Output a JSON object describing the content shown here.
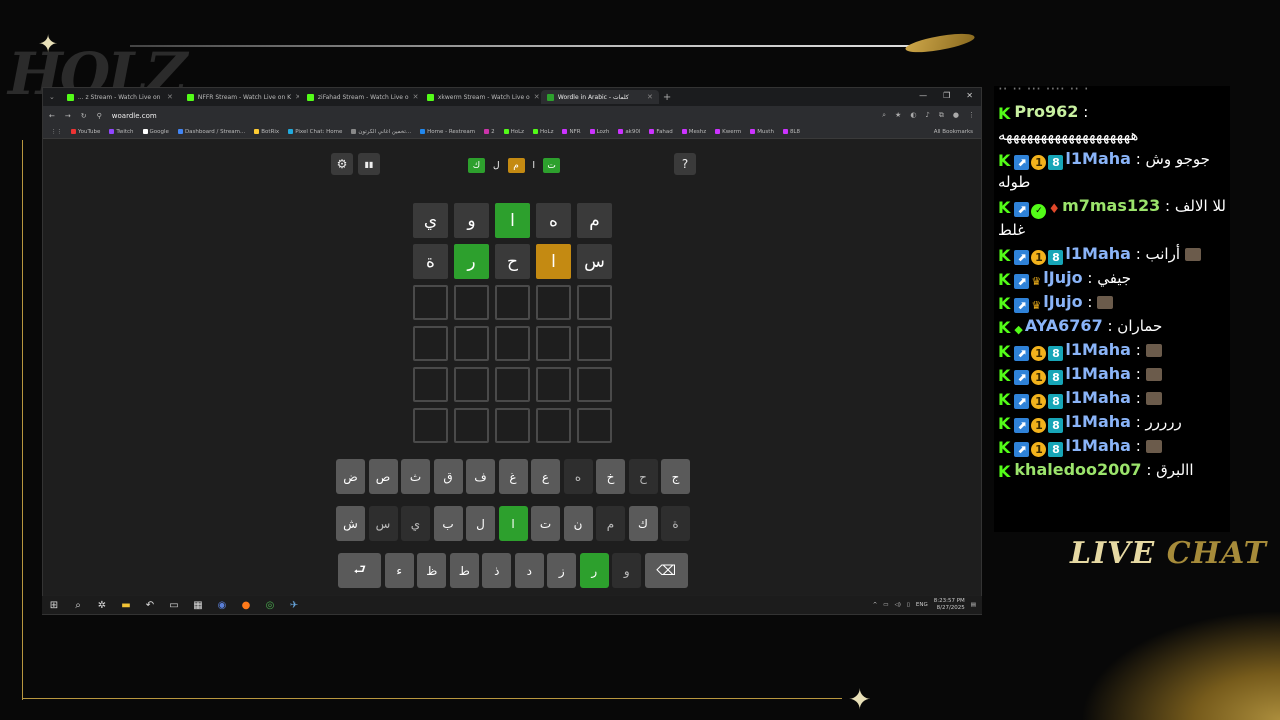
{
  "overlay": {
    "logo_text": "HOLZ",
    "live_label": "LIVE",
    "chat_label": "CHAT"
  },
  "browser": {
    "tabs": [
      {
        "label": "... z Stream - Watch Live on",
        "active": false
      },
      {
        "label": "NFFR Stream - Watch Live on K",
        "active": false
      },
      {
        "label": "ziFahad Stream - Watch Live o",
        "active": false
      },
      {
        "label": "xkwerm Stream - Watch Live o",
        "active": false
      },
      {
        "label": "Wordle in Arabic - كلمات",
        "active": true
      }
    ],
    "new_tab": "+",
    "url": "woardle.com",
    "bookmarks": [
      "YouTube",
      "Twitch",
      "Google",
      "Dashboard / Stream...",
      "BotRix",
      "Pixel Chat: Home",
      "تخمين اغاني الكرتون...",
      "Home - Restream",
      "2",
      "HoLz",
      "HoLz",
      "NFR",
      "Lozh",
      "ak90l",
      "Fahad",
      "Meshz",
      "Kwerm",
      "Musth",
      "8L8"
    ],
    "all_bookmarks": "All Bookmarks"
  },
  "game": {
    "settings_icon": "⚙",
    "stats_icon": "▮▮",
    "help_label": "?",
    "title_tiles": [
      {
        "char": "ك",
        "state": "green"
      },
      {
        "char": "ل",
        "state": "none"
      },
      {
        "char": "م",
        "state": "yellow"
      },
      {
        "char": "ا",
        "state": "none"
      },
      {
        "char": "ت",
        "state": "green"
      }
    ],
    "board": [
      [
        {
          "c": "ي",
          "s": "filled"
        },
        {
          "c": "و",
          "s": "filled"
        },
        {
          "c": "ا",
          "s": "green"
        },
        {
          "c": "ه",
          "s": "filled"
        },
        {
          "c": "م",
          "s": "filled"
        }
      ],
      [
        {
          "c": "ة",
          "s": "filled"
        },
        {
          "c": "ر",
          "s": "green"
        },
        {
          "c": "ح",
          "s": "filled"
        },
        {
          "c": "ا",
          "s": "yellow"
        },
        {
          "c": "س",
          "s": "filled"
        }
      ],
      [
        {
          "c": "",
          "s": "empty"
        },
        {
          "c": "",
          "s": "empty"
        },
        {
          "c": "",
          "s": "empty"
        },
        {
          "c": "",
          "s": "empty"
        },
        {
          "c": "",
          "s": "empty"
        }
      ],
      [
        {
          "c": "",
          "s": "empty"
        },
        {
          "c": "",
          "s": "empty"
        },
        {
          "c": "",
          "s": "empty"
        },
        {
          "c": "",
          "s": "empty"
        },
        {
          "c": "",
          "s": "empty"
        }
      ],
      [
        {
          "c": "",
          "s": "empty"
        },
        {
          "c": "",
          "s": "empty"
        },
        {
          "c": "",
          "s": "empty"
        },
        {
          "c": "",
          "s": "empty"
        },
        {
          "c": "",
          "s": "empty"
        }
      ],
      [
        {
          "c": "",
          "s": "empty"
        },
        {
          "c": "",
          "s": "empty"
        },
        {
          "c": "",
          "s": "empty"
        },
        {
          "c": "",
          "s": "empty"
        },
        {
          "c": "",
          "s": "empty"
        }
      ]
    ],
    "keyboard": [
      [
        {
          "k": "ض"
        },
        {
          "k": "ص"
        },
        {
          "k": "ث"
        },
        {
          "k": "ق"
        },
        {
          "k": "ف"
        },
        {
          "k": "غ"
        },
        {
          "k": "ع"
        },
        {
          "k": "ه",
          "s": "used"
        },
        {
          "k": "خ"
        },
        {
          "k": "ح",
          "s": "used"
        },
        {
          "k": "ج"
        }
      ],
      [
        {
          "k": "ش"
        },
        {
          "k": "س",
          "s": "used"
        },
        {
          "k": "ي",
          "s": "used"
        },
        {
          "k": "ب"
        },
        {
          "k": "ل"
        },
        {
          "k": "ا",
          "s": "green"
        },
        {
          "k": "ت"
        },
        {
          "k": "ن"
        },
        {
          "k": "م",
          "s": "used"
        },
        {
          "k": "ك"
        },
        {
          "k": "ة",
          "s": "used"
        }
      ],
      [
        {
          "k": "⮐",
          "s": "wide"
        },
        {
          "k": "ء"
        },
        {
          "k": "ظ"
        },
        {
          "k": "ط"
        },
        {
          "k": "ذ"
        },
        {
          "k": "د"
        },
        {
          "k": "ز"
        },
        {
          "k": "ر",
          "s": "green"
        },
        {
          "k": "و",
          "s": "used"
        },
        {
          "k": "⌫",
          "s": "wide"
        }
      ]
    ]
  },
  "taskbar": {
    "lang": "ENG",
    "time": "8:23:57 PM",
    "date": "8/27/2025"
  },
  "chat": {
    "messages": [
      {
        "badges": [
          "kick"
        ],
        "user": "Pro962",
        "user_color": "#c8f0a0",
        "text": "هههههههههههههههههههه"
      },
      {
        "badges": [
          "kick",
          "blue",
          "gold",
          "sub"
        ],
        "user": "l1Maha",
        "user_color": "#8ab4f8",
        "text": "جوجو وش طوله"
      },
      {
        "badges": [
          "kick",
          "blue",
          "verified",
          "red"
        ],
        "user": "m7mas123",
        "user_color": "#9be36b",
        "text": "للا الالف غلط"
      },
      {
        "badges": [
          "kick",
          "blue",
          "gold",
          "sub"
        ],
        "user": "l1Maha",
        "user_color": "#8ab4f8",
        "text": "أرانب",
        "emote": true
      },
      {
        "badges": [
          "kick",
          "blue",
          "crown"
        ],
        "user": "lJujo",
        "user_color": "#8ab4f8",
        "text": "جيفي"
      },
      {
        "badges": [
          "kick",
          "blue",
          "crown"
        ],
        "user": "lJujo",
        "user_color": "#8ab4f8",
        "text": "",
        "emote": true
      },
      {
        "badges": [
          "kick",
          "og"
        ],
        "user": "AYA6767",
        "user_color": "#8ab4f8",
        "text": "حماران"
      },
      {
        "badges": [
          "kick",
          "blue",
          "gold",
          "sub"
        ],
        "user": "l1Maha",
        "user_color": "#8ab4f8",
        "text": "",
        "emote": true
      },
      {
        "badges": [
          "kick",
          "blue",
          "gold",
          "sub"
        ],
        "user": "l1Maha",
        "user_color": "#8ab4f8",
        "text": "",
        "emote": true
      },
      {
        "badges": [
          "kick",
          "blue",
          "gold",
          "sub"
        ],
        "user": "l1Maha",
        "user_color": "#8ab4f8",
        "text": "",
        "emote": true
      },
      {
        "badges": [
          "kick",
          "blue",
          "gold",
          "sub"
        ],
        "user": "l1Maha",
        "user_color": "#8ab4f8",
        "text": "ررررر"
      },
      {
        "badges": [
          "kick",
          "blue",
          "gold",
          "sub"
        ],
        "user": "l1Maha",
        "user_color": "#8ab4f8",
        "text": "",
        "emote": true
      },
      {
        "badges": [
          "kick"
        ],
        "user": "khaledoo2007",
        "user_color": "#9be36b",
        "text": "االبرق"
      }
    ]
  },
  "colors": {
    "green": "#2da02d",
    "yellow": "#c48a12",
    "kick_green": "#53fc18",
    "gold_accent": "#b8973f"
  }
}
